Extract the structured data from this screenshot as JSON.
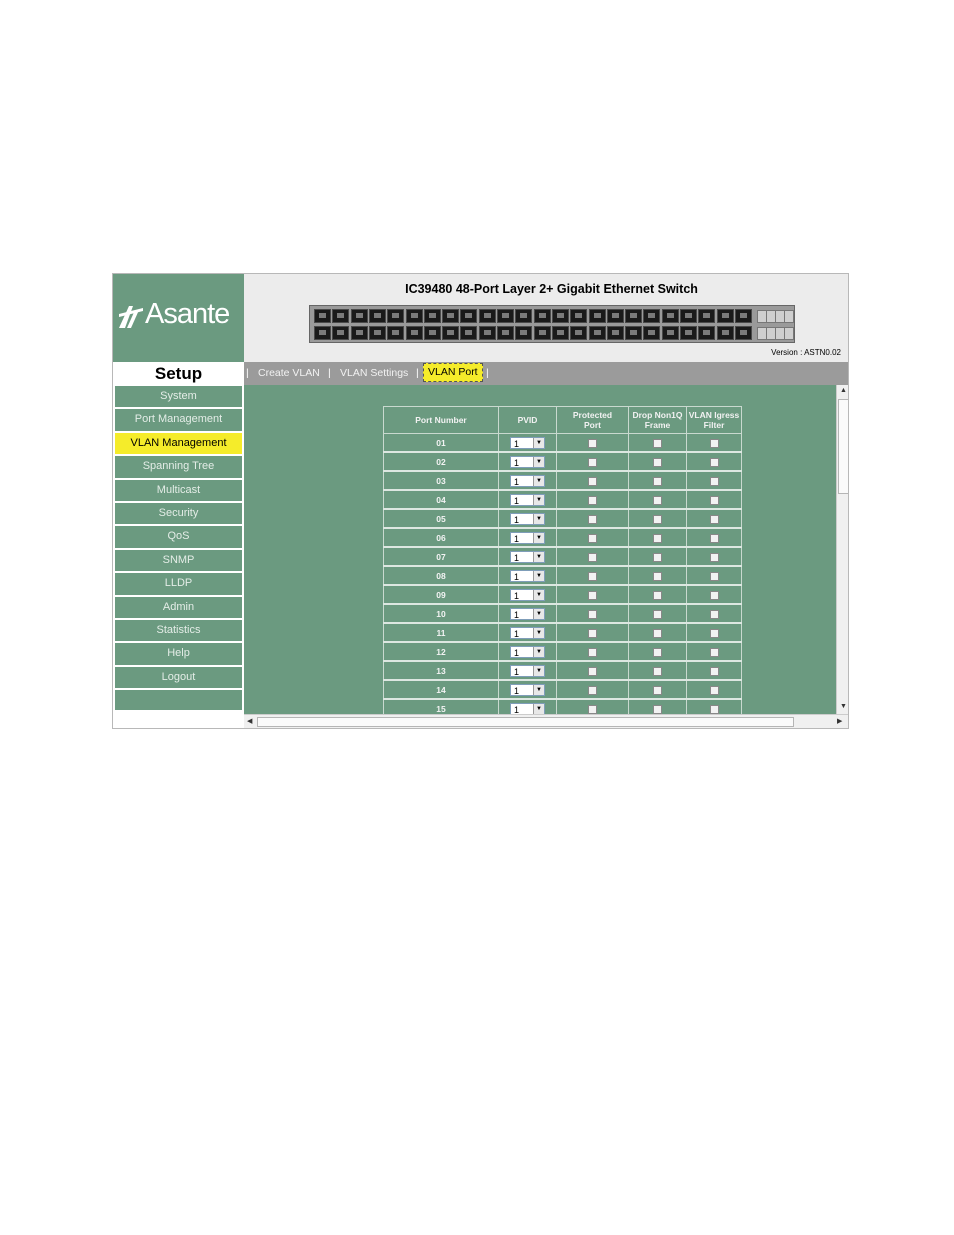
{
  "brand": {
    "logo_text": "Asante"
  },
  "header": {
    "title": "IC39480 48-Port Layer 2+ Gigabit Ethernet Switch",
    "version_label": "Version :",
    "version_value": "ASTN0.02"
  },
  "sidebar": {
    "title": "Setup",
    "items": [
      {
        "label": "System",
        "active": false
      },
      {
        "label": "Port Management",
        "active": false
      },
      {
        "label": "VLAN Management",
        "active": true
      },
      {
        "label": "Spanning Tree",
        "active": false
      },
      {
        "label": "Multicast",
        "active": false
      },
      {
        "label": "Security",
        "active": false
      },
      {
        "label": "QoS",
        "active": false
      },
      {
        "label": "SNMP",
        "active": false
      },
      {
        "label": "LLDP",
        "active": false
      },
      {
        "label": "Admin",
        "active": false
      },
      {
        "label": "Statistics",
        "active": false
      },
      {
        "label": "Help",
        "active": false
      },
      {
        "label": "Logout",
        "active": false
      }
    ]
  },
  "tabs": {
    "separator": "|",
    "items": [
      {
        "label": "Create VLAN",
        "active": false
      },
      {
        "label": "VLAN Settings",
        "active": false
      },
      {
        "label": "VLAN Port",
        "active": true
      }
    ]
  },
  "table": {
    "headers": {
      "port_number": "Port Number",
      "pvid": "PVID",
      "protected_port_1": "Protected",
      "protected_port_2": "Port",
      "drop_non1q_1": "Drop Non1Q",
      "drop_non1q_2": "Frame",
      "ingress_1": "VLAN Igress",
      "ingress_2": "Filter"
    },
    "rows": [
      {
        "port": "01",
        "pvid": "1"
      },
      {
        "port": "02",
        "pvid": "1"
      },
      {
        "port": "03",
        "pvid": "1"
      },
      {
        "port": "04",
        "pvid": "1"
      },
      {
        "port": "05",
        "pvid": "1"
      },
      {
        "port": "06",
        "pvid": "1"
      },
      {
        "port": "07",
        "pvid": "1"
      },
      {
        "port": "08",
        "pvid": "1"
      },
      {
        "port": "09",
        "pvid": "1"
      },
      {
        "port": "10",
        "pvid": "1"
      },
      {
        "port": "11",
        "pvid": "1"
      },
      {
        "port": "12",
        "pvid": "1"
      },
      {
        "port": "13",
        "pvid": "1"
      },
      {
        "port": "14",
        "pvid": "1"
      },
      {
        "port": "15",
        "pvid": "1"
      }
    ]
  },
  "colors": {
    "panel_green": "#6b9a80",
    "active_yellow": "#f5ec2a",
    "tabbar_gray": "#9b9b9b"
  }
}
